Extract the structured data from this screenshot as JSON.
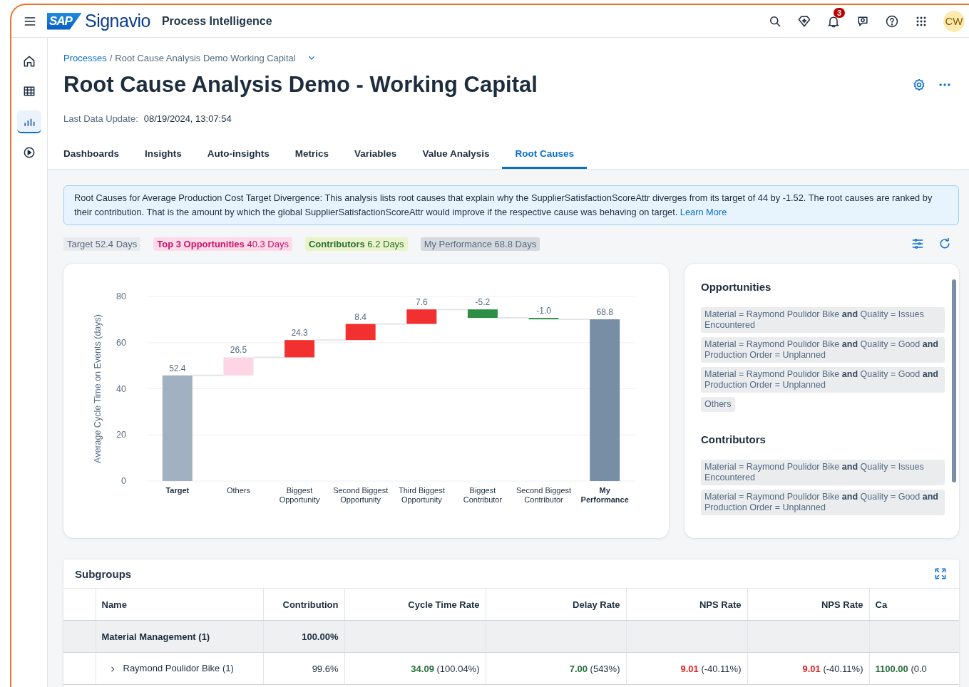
{
  "header": {
    "logo_mark": "SAP",
    "app_name": "Signavio",
    "product": "Process Intelligence",
    "notification_count": "3",
    "avatar_initials": "CW"
  },
  "sidebar": {
    "items": [
      {
        "kind": "home",
        "selected": false
      },
      {
        "kind": "table",
        "selected": false
      },
      {
        "kind": "chart",
        "selected": true
      },
      {
        "kind": "play",
        "selected": false
      }
    ]
  },
  "breadcrumb": {
    "link": "Processes",
    "separator": "/",
    "current": "Root Cause Analysis Demo Working Capital"
  },
  "page_title": "Root Cause Analysis Demo - Working Capital",
  "last_update": {
    "label": "Last Data Update:",
    "value": "08/19/2024, 13:07:54"
  },
  "tabs": [
    {
      "label": "Dashboards",
      "selected": false
    },
    {
      "label": "Insights",
      "selected": false
    },
    {
      "label": "Auto-insights",
      "selected": false
    },
    {
      "label": "Metrics",
      "selected": false
    },
    {
      "label": "Variables",
      "selected": false
    },
    {
      "label": "Value Analysis",
      "selected": false
    },
    {
      "label": "Root Causes",
      "selected": true
    }
  ],
  "info": {
    "text": "Root Causes for Average Production Cost Target Divergence: This analysis lists root causes that explain why the SupplierSatisfactionScoreAttr diverges from its target of 44 by -1.52. The root causes are ranked by their  contribution. That is the amount by which the global SupplierSatisfactionScoreAttr would improve if the respective cause was behaving on target.",
    "link": "Learn More"
  },
  "stats": [
    {
      "kind": "target",
      "label": "Target",
      "value": "52.4 Days"
    },
    {
      "kind": "opportunity",
      "label": "Top 3 Opportunities",
      "value": "40.3 Days"
    },
    {
      "kind": "contributor",
      "label": "Contributors",
      "value": "6.2 Days"
    },
    {
      "kind": "performance",
      "label": "My Performance",
      "value": "68.8 Days"
    }
  ],
  "chart": {
    "y_axis_title": "Average Cycle Time on Events (days)",
    "y_tick_labels": [
      "80",
      "60",
      "40",
      "20",
      "0"
    ],
    "bars": [
      {
        "kind": "total",
        "category": "Target",
        "label": "52.4",
        "color": "#a2b1c1"
      },
      {
        "kind": "up",
        "category": "Others",
        "label": "26.5",
        "color": "#fdd5e4"
      },
      {
        "kind": "up",
        "category": "Biggest Opportunity",
        "label": "24.3",
        "color": "#f23030"
      },
      {
        "kind": "up",
        "category": "Second Biggest Opportunity",
        "label": "8.4",
        "color": "#f23030"
      },
      {
        "kind": "up",
        "category": "Third Biggest Opportunity",
        "label": "7.6",
        "color": "#f23030"
      },
      {
        "kind": "down",
        "category": "Biggest Contributor",
        "label": "-5.2",
        "color": "#2d8f46"
      },
      {
        "kind": "down",
        "category": "Second Biggest Contributor",
        "label": "-1.0",
        "color": "#2d8f46"
      },
      {
        "kind": "total",
        "category": "My Performance",
        "label": "68.8",
        "color": "#788ea5"
      }
    ]
  },
  "panel": {
    "sections": [
      {
        "title": "Opportunities",
        "items": [
          "Material = Raymond Poulidor Bike **and** Quality = Issues Encountered",
          "Material = Raymond Poulidor Bike **and** Quality = Good **and** Production Order = Unplanned",
          "Material = Raymond Poulidor Bike **and** Quality = Good **and** Production Order = Unplanned",
          "Others"
        ]
      },
      {
        "title": "Contributors",
        "items": [
          "Material = Raymond Poulidor Bike **and** Quality = Issues Encountered",
          "Material = Raymond Poulidor Bike **and** Quality = Good **and** Production Order = Unplanned"
        ]
      }
    ]
  },
  "subgroups": {
    "title": "Subgroups",
    "columns": [
      "Name",
      "Contribution",
      "Cycle Time Rate",
      "Delay Rate",
      "NPS Rate",
      "NPS Rate",
      "Ca"
    ],
    "rows": [
      {
        "kind": "group",
        "cells": [
          {
            "value": "Material Management (1)"
          },
          {
            "value": "100.00%"
          }
        ]
      },
      {
        "kind": "item",
        "expanded": false,
        "cells": [
          {
            "value": "Raymond Poulidor Bike (1)"
          },
          {
            "value": "99.6%"
          },
          {
            "value": "34.09",
            "delta": "(100.04%)",
            "color": "#256f3a"
          },
          {
            "value": "7.00",
            "delta": "(543%)",
            "color": "#256f3a"
          },
          {
            "value": "9.01",
            "delta": "(-40.11%)",
            "color": "#e62020"
          },
          {
            "value": "9.01",
            "delta": "(-40.11%)",
            "color": "#e62020"
          },
          {
            "value": "1100.00",
            "delta": "(0.0",
            "color": "#256f3a"
          }
        ]
      }
    ]
  }
}
